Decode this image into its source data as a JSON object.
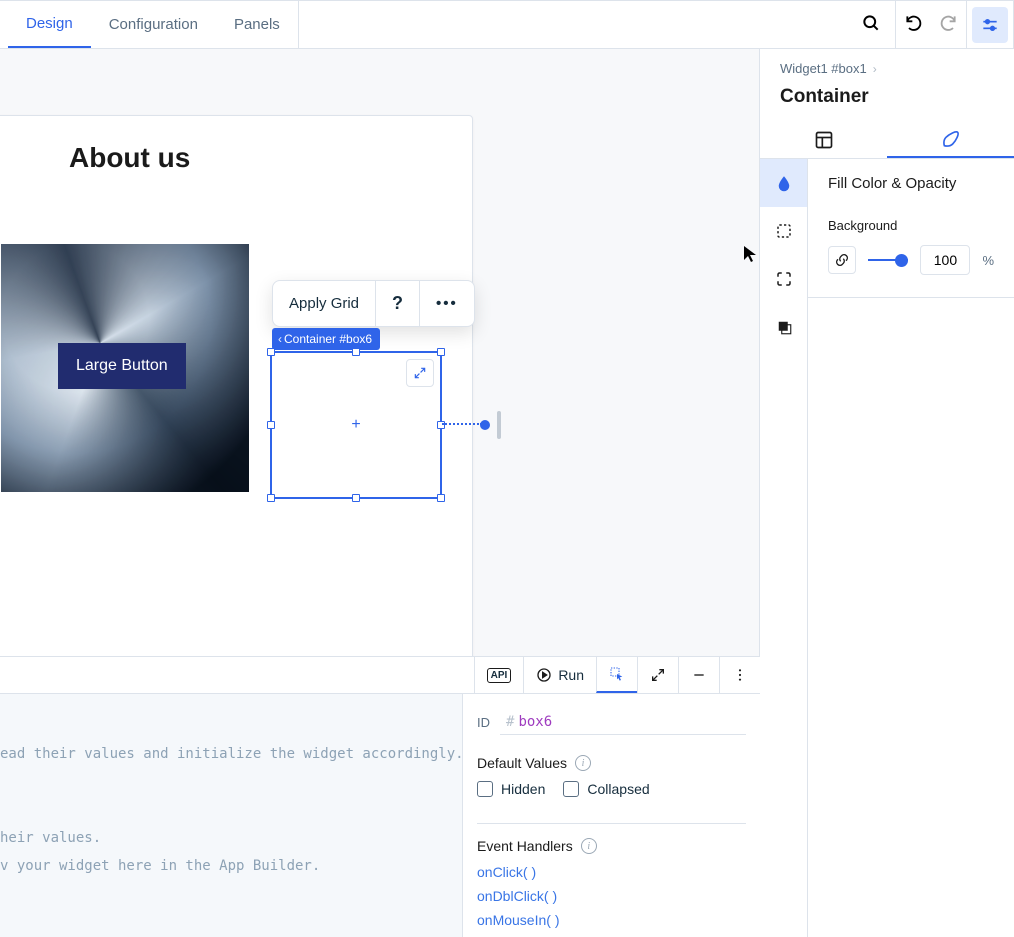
{
  "tabs": {
    "design": "Design",
    "config": "Configuration",
    "panels": "Panels"
  },
  "canvas": {
    "page_heading": "About us",
    "large_button": "Large Button",
    "ctx_apply_grid": "Apply Grid",
    "sel_chip": "Container #box6"
  },
  "sidePanel": {
    "breadcrumb": "Widget1 #box1",
    "title": "Container",
    "section_title": "Fill Color & Opacity",
    "background_label": "Background",
    "opacity_value": "100",
    "opacity_unit": "%"
  },
  "bottomToolbar": {
    "api": "API",
    "run": "Run"
  },
  "code": {
    "l1": "ead their values and initialize the widget accordingly.",
    "l2": "heir values.",
    "l3": "v your widget here in the App Builder."
  },
  "propsPanel": {
    "id_label": "ID",
    "id_hash": "#",
    "id_value": "box6",
    "defaults_title": "Default Values",
    "chk_hidden": "Hidden",
    "chk_collapsed": "Collapsed",
    "events_title": "Event Handlers",
    "ev_click": "onClick( )",
    "ev_dbl": "onDblClick( )",
    "ev_mouse": "onMouseIn( )"
  }
}
